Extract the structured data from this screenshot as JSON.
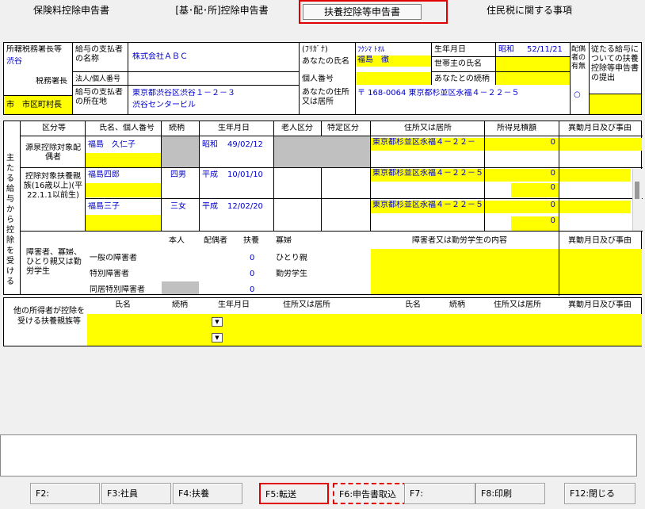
{
  "tabs": [
    "保険料控除申告書",
    "[基･配･所]控除申告書",
    "扶養控除等申告書",
    "住民税に関する事項"
  ],
  "header": {
    "tax_office_label": "所轄税務署長等",
    "tax_office_value": "渋谷",
    "tax_office_suffix": "税務署長",
    "city_label": "市　市区町村長",
    "payer_name_label": "給与の支払者の名称",
    "payer_name_value": "株式会社ＡＢＣ",
    "corp_number_label": "法人/個人番号",
    "payer_address_label": "給与の支払者の所在地",
    "payer_address_line1": "東京都渋谷区渋谷１－２－３",
    "payer_address_line2": "渋谷センタービル",
    "furigana_label": "(ﾌﾘｶﾞﾅ)",
    "furigana_value": "ﾌｸｼﾏ ﾄｵﾙ",
    "name_label": "あなたの氏名",
    "name_value": "福島　徹",
    "my_number_label": "個人番号",
    "address_label": "あなたの住所又は居所",
    "address_value": "〒 168-0064 東京都杉並区永福４－２２－５",
    "dob_label": "生年月日",
    "dob_era": "昭和",
    "dob_value": "52/11/21",
    "household_label": "世帯主の氏名",
    "relation_label": "あなたとの続柄",
    "spouse_label": "配偶者の有無",
    "spouse_value": "○",
    "other_submit_label": "従たる給与についての扶養控除等申告書の提出"
  },
  "main": {
    "side_label": "主たる給与から控除を受ける",
    "headers": [
      "区分等",
      "氏名、個人番号",
      "続柄",
      "生年月日",
      "老人区分",
      "特定区分",
      "住所又は居所",
      "所得見積額",
      "異動月日及び事由"
    ],
    "spouse_section_label": "源泉控除対象配偶者",
    "dependents_section_label": "控除対象扶養親族(16歳以上)(平22.1.1以前生)",
    "rows": [
      {
        "name": "福島　久仁子",
        "relation": "",
        "era": "昭和",
        "dob": "49/02/12",
        "address": "東京都杉並区永福４－２２－",
        "income": "0"
      },
      {
        "name": "福島四郎",
        "relation": "四男",
        "era": "平成",
        "dob": "10/01/10",
        "address": "東京都杉並区永福４－２２－５",
        "income": "0",
        "income2": "0"
      },
      {
        "name": "福島三子",
        "relation": "三女",
        "era": "平成",
        "dob": "12/02/20",
        "address": "東京都杉並区永福４－２２－５",
        "income": "0",
        "income2": "0"
      }
    ],
    "disability_section_label": "障害者、寡婦、ひとり親又は勤労学生",
    "disability_headers": [
      "本人",
      "配偶者",
      "扶養",
      "寡婦",
      "障害者又は勤労学生の内容",
      "異動月日及び事由"
    ],
    "disability_rows": [
      {
        "label": "一般の障害者",
        "value": "0"
      },
      {
        "label": "特別障害者",
        "value": "0"
      },
      {
        "label": "同居特別障害者",
        "value": "0"
      }
    ],
    "status_items": [
      "ひとり親",
      "勤労学生"
    ]
  },
  "other": {
    "section_label": "他の所得者が控除を受ける扶養親族等",
    "headers": [
      "氏名",
      "続柄",
      "生年月日",
      "住所又は居所",
      "氏名",
      "続柄",
      "住所又は居所",
      "異動月日及び事由"
    ]
  },
  "fkeys": [
    "F2:",
    "F3:社員",
    "F4:扶養",
    "F5:転送",
    "F6:申告書取込",
    "F7:",
    "F8:印刷",
    "F12:閉じる"
  ],
  "highlight_color": "#ff0000",
  "field_color": "#ffff00"
}
